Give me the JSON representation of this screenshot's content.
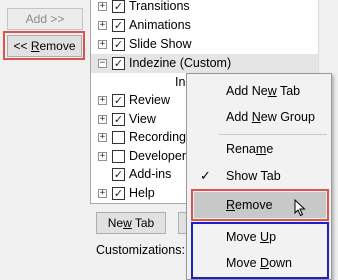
{
  "left_panel": {
    "add_button": {
      "pre": "Add >>",
      "ul": "",
      "post": ""
    },
    "remove_button": {
      "pre": "<< ",
      "ul": "R",
      "post": "emove"
    }
  },
  "tree_items": [
    {
      "label": "Transitions",
      "expander": "+",
      "checked": true
    },
    {
      "label": "Animations",
      "expander": "+",
      "checked": true
    },
    {
      "label": "Slide Show",
      "expander": "+",
      "checked": true
    },
    {
      "label": "Indezine (Custom)",
      "expander": "−",
      "checked": true
    },
    {
      "label": "Indezine",
      "expander": "",
      "checked": null
    },
    {
      "label": "Review",
      "expander": "+",
      "checked": true
    },
    {
      "label": "View",
      "expander": "+",
      "checked": true
    },
    {
      "label": "Recording",
      "expander": "+",
      "checked": false
    },
    {
      "label": "Developer",
      "expander": "+",
      "checked": false
    },
    {
      "label": "Add-ins",
      "expander": "",
      "checked": true
    },
    {
      "label": "Help",
      "expander": "+",
      "checked": true
    }
  ],
  "bottom": {
    "new_tab": {
      "pre": "Ne",
      "ul": "w",
      "post": " Tab"
    },
    "customizations_label": "Customizations:"
  },
  "context_menu": {
    "items": [
      {
        "pre": "Add Ne",
        "ul": "w",
        "post": " Tab",
        "check": ""
      },
      {
        "pre": "Add ",
        "ul": "N",
        "post": "ew Group",
        "check": ""
      },
      {
        "pre": "Rena",
        "ul": "m",
        "post": "e",
        "check": ""
      },
      {
        "pre": "Show Tab",
        "ul": "",
        "post": "",
        "check": "✓"
      },
      {
        "pre": "",
        "ul": "R",
        "post": "emove",
        "check": ""
      },
      {
        "pre": "Move ",
        "ul": "U",
        "post": "p",
        "check": ""
      },
      {
        "pre": "Move ",
        "ul": "D",
        "post": "own",
        "check": ""
      }
    ]
  },
  "colors": {
    "highlight_red": "#d9534f",
    "highlight_blue": "#1f1fc7"
  }
}
